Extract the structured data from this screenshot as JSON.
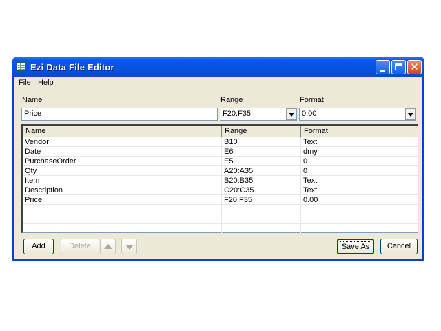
{
  "window": {
    "title": "Ezi Data File Editor"
  },
  "menu": {
    "file": "File",
    "file_mnemonic": "F",
    "file_rest": "ile",
    "help": "Help",
    "help_mnemonic": "H",
    "help_rest": "elp"
  },
  "labels": {
    "name": "Name",
    "range": "Range",
    "format": "Format"
  },
  "inputs": {
    "name_value": "Price",
    "range_value": "F20:F35",
    "format_value": "0.00"
  },
  "grid": {
    "headers": [
      "Name",
      "Range",
      "Format"
    ],
    "rows": [
      {
        "name": "Vendor",
        "range": "B10",
        "format": "Text"
      },
      {
        "name": "Date",
        "range": "E6",
        "format": "dmy"
      },
      {
        "name": "PurchaseOrder",
        "range": "E5",
        "format": "0"
      },
      {
        "name": "Qty",
        "range": "A20:A35",
        "format": "0"
      },
      {
        "name": "Item",
        "range": "B20:B35",
        "format": "Text"
      },
      {
        "name": "Description",
        "range": "C20:C35",
        "format": "Text"
      },
      {
        "name": "Price",
        "range": "F20:F35",
        "format": "0.00"
      },
      {
        "name": "",
        "range": "",
        "format": ""
      },
      {
        "name": "",
        "range": "",
        "format": ""
      },
      {
        "name": "",
        "range": "",
        "format": ""
      }
    ]
  },
  "buttons": {
    "add": "Add",
    "delete": "Delete",
    "save_as": "Save As",
    "cancel": "Cancel"
  },
  "icons": {
    "app": "app-grid-icon",
    "up": "move-up-icon",
    "down": "move-down-icon"
  }
}
